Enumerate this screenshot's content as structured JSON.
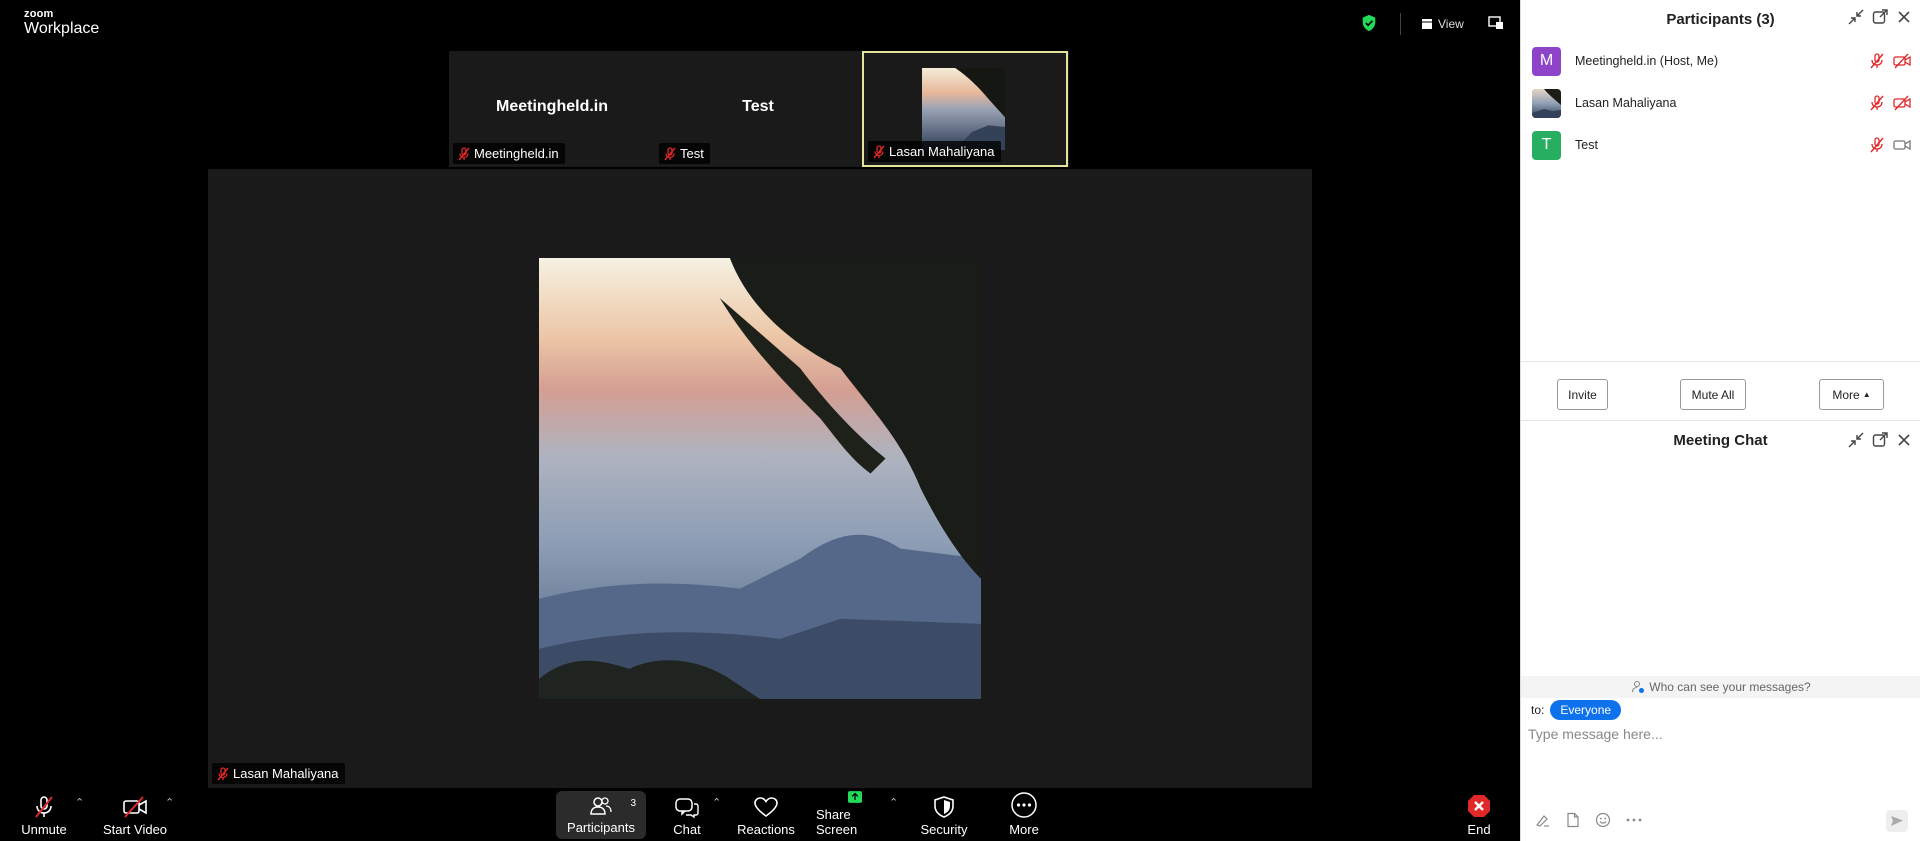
{
  "app": {
    "logo_small": "zoom",
    "logo_large": "Workplace"
  },
  "topbar": {
    "view_label": "View",
    "encryption_color": "#23d959"
  },
  "thumbnails": [
    {
      "name": "Meetingheld.in",
      "label": "Meetingheld.in",
      "mic": "muted"
    },
    {
      "name": "Test",
      "label": "Test",
      "mic": "muted"
    },
    {
      "name": "Lasan Mahaliyana",
      "label": "Lasan Mahaliyana",
      "mic": "muted",
      "has_video": true,
      "active_speaker": true
    }
  ],
  "main_video": {
    "name": "Lasan Mahaliyana",
    "mic": "muted"
  },
  "toolbar": {
    "unmute": "Unmute",
    "start_video": "Start Video",
    "participants": "Participants",
    "participants_count": "3",
    "chat": "Chat",
    "reactions": "Reactions",
    "share_screen": "Share Screen",
    "security": "Security",
    "more": "More",
    "end": "End"
  },
  "participants_panel": {
    "title": "Participants (3)",
    "items": [
      {
        "name": "Meetingheld.in (Host, Me)",
        "initial": "M",
        "avatar_color": "#8e44c8",
        "mic": "muted",
        "video": "off"
      },
      {
        "name": "Lasan Mahaliyana",
        "initial": "",
        "avatar_color": "#4a5a70",
        "mic": "muted",
        "video": "off"
      },
      {
        "name": "Test",
        "initial": "T",
        "avatar_color": "#27ae60",
        "mic": "muted",
        "video": "on"
      }
    ],
    "invite": "Invite",
    "mute_all": "Mute All",
    "more": "More"
  },
  "chat_panel": {
    "title": "Meeting Chat",
    "who_can_see": "Who can see your messages?",
    "to_label": "to:",
    "recipient": "Everyone",
    "placeholder": "Type message here..."
  }
}
